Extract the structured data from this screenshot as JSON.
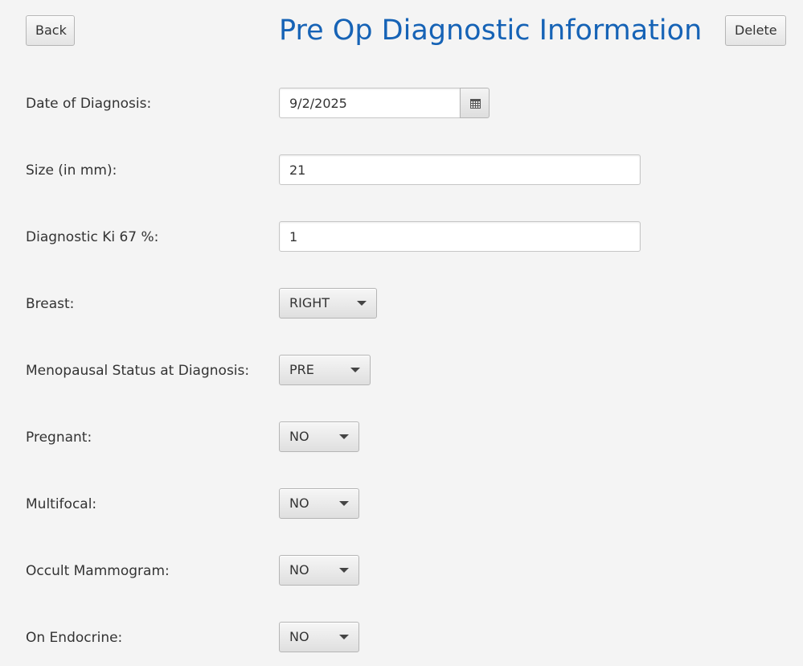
{
  "header": {
    "back_label": "Back",
    "title": "Pre Op Diagnostic Information",
    "delete_label": "Delete"
  },
  "form": {
    "date_of_diagnosis": {
      "label": "Date of Diagnosis:",
      "value": "9/2/2025",
      "icon": "calendar-icon"
    },
    "size": {
      "label": "Size (in mm):",
      "value": "21"
    },
    "ki67": {
      "label": "Diagnostic Ki 67 %:",
      "value": "1"
    },
    "breast": {
      "label": "Breast:",
      "value": "RIGHT"
    },
    "menopausal_status": {
      "label": "Menopausal Status at Diagnosis:",
      "value": "PRE"
    },
    "pregnant": {
      "label": "Pregnant:",
      "value": "NO"
    },
    "multifocal": {
      "label": "Multifocal:",
      "value": "NO"
    },
    "occult_mammogram": {
      "label": "Occult Mammogram:",
      "value": "NO"
    },
    "on_endocrine": {
      "label": "On Endocrine:",
      "value": "NO"
    }
  },
  "colors": {
    "title": "#1663b6",
    "background": "#f4f4f4"
  }
}
